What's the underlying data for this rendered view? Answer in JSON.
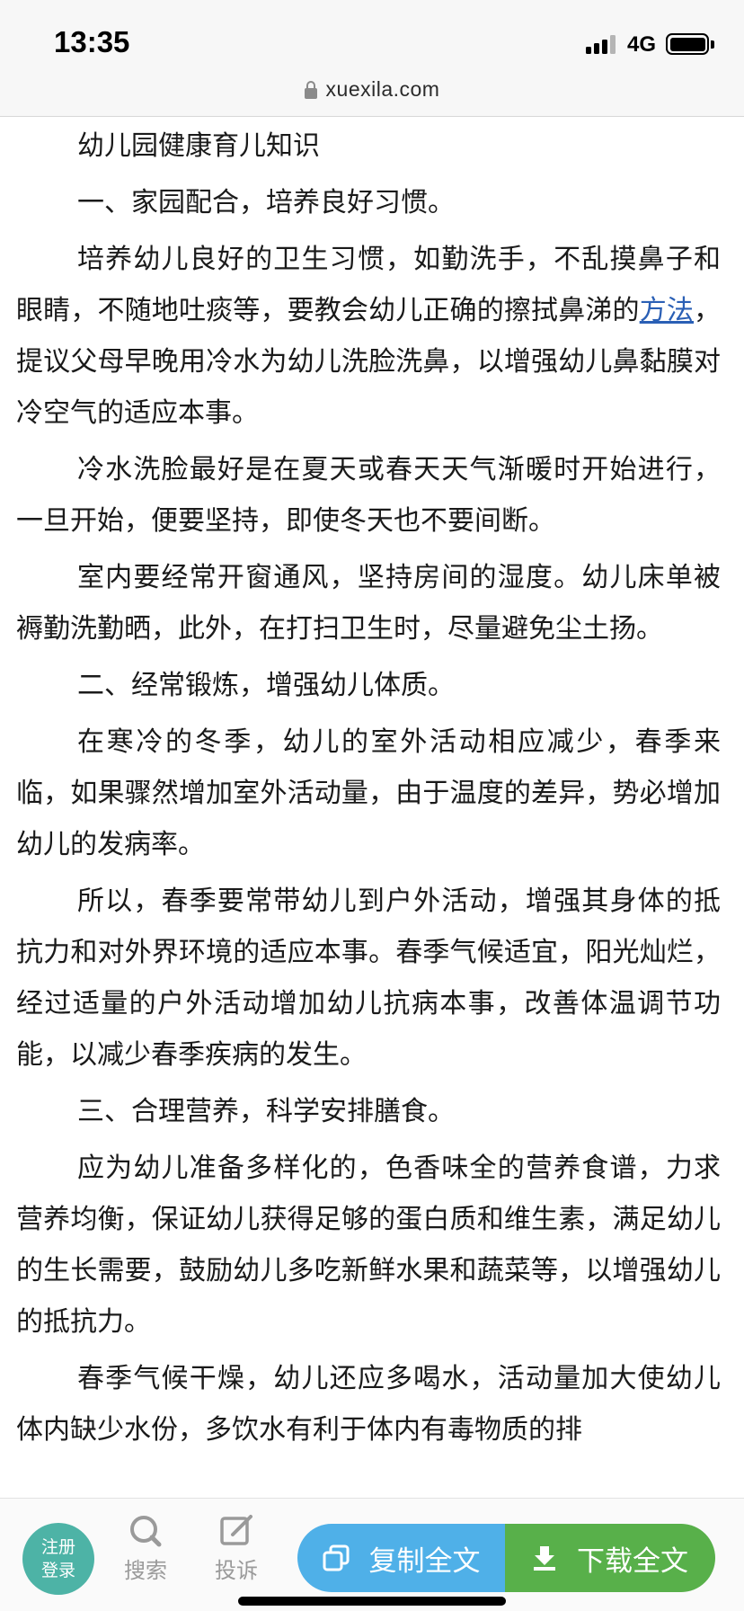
{
  "status_bar": {
    "time": "13:35",
    "network": "4G",
    "icons": [
      "signal-icon",
      "battery-icon"
    ]
  },
  "url_bar": {
    "domain": "xuexila.com",
    "icon": "lock-icon"
  },
  "article": {
    "paragraphs": [
      "幼儿园健康育儿知识",
      "一、家园配合，培养良好习惯。",
      {
        "before_link": "培养幼儿良好的卫生习惯，如勤洗手，不乱摸鼻子和眼睛，不随地吐痰等，要教会幼儿正确的擦拭鼻涕的",
        "link": "方法",
        "after_link": "，提议父母早晚用冷水为幼儿洗脸洗鼻，以增强幼儿鼻黏膜对冷空气的适应本事。"
      },
      "冷水洗脸最好是在夏天或春天天气渐暖时开始进行，一旦开始，便要坚持，即使冬天也不要间断。",
      "室内要经常开窗通风，坚持房间的湿度。幼儿床单被褥勤洗勤晒，此外，在打扫卫生时，尽量避免尘土扬。",
      "二、经常锻炼，增强幼儿体质。",
      "在寒冷的冬季，幼儿的室外活动相应减少，春季来临，如果骤然增加室外活动量，由于温度的差异，势必增加幼儿的发病率。",
      "所以，春季要常带幼儿到户外活动，增强其身体的抵抗力和对外界环境的适应本事。春季气候适宜，阳光灿烂，经过适量的户外活动增加幼儿抗病本事，改善体温调节功能，以减少春季疾病的发生。",
      "三、合理营养，科学安排膳食。",
      "应为幼儿准备多样化的，色香味全的营养食谱，力求营养均衡，保证幼儿获得足够的蛋白质和维生素，满足幼儿的生长需要，鼓励幼儿多吃新鲜水果和蔬菜等，以增强幼儿的抵抗力。",
      "春季气候干燥，幼儿还应多喝水，活动量加大使幼儿体内缺少水份，多饮水有利于体内有毒物质的排"
    ]
  },
  "bottom_bar": {
    "register_line1": "注册",
    "register_line2": "登录",
    "search_label": "搜索",
    "report_label": "投诉",
    "copy_label": "复制全文",
    "download_label": "下载全文",
    "colors": {
      "register": "#4db3a6",
      "copy": "#4fb0e8",
      "download": "#58b04a",
      "link": "#2a5fb5"
    }
  }
}
